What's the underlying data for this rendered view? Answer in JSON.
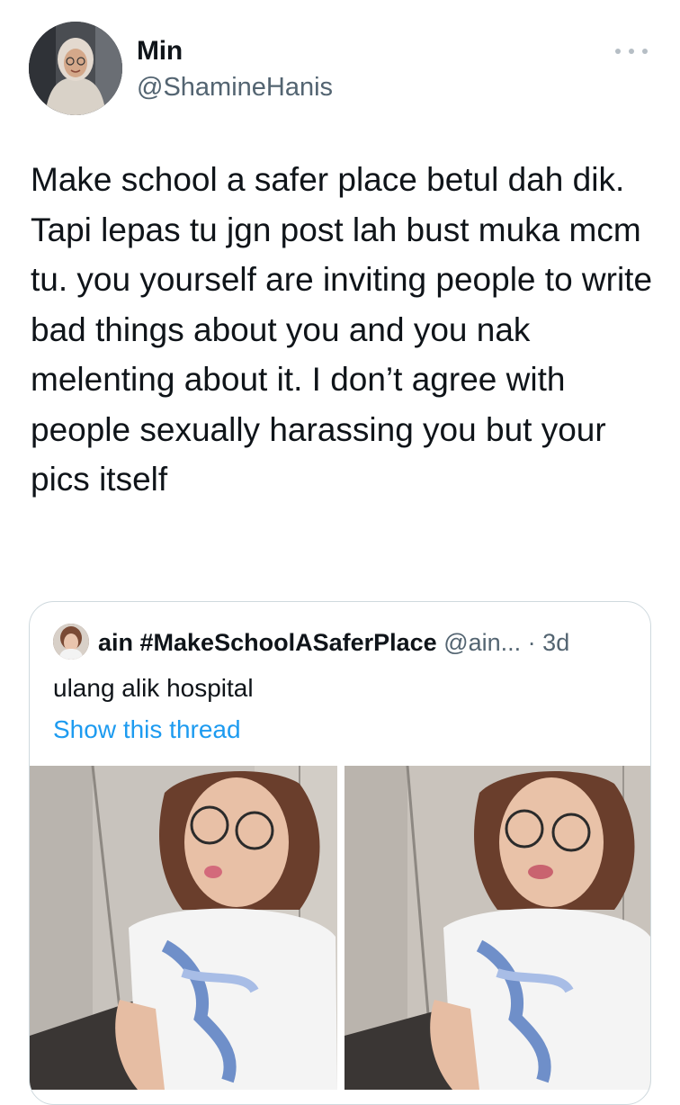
{
  "tweet": {
    "display_name": "Min",
    "handle": "@ShamineHanis",
    "more_icon": "more-horizontal-icon",
    "text": "Make school a safer place betul dah dik. Tapi lepas tu jgn post lah bust muka mcm tu. you yourself are inviting people to write bad things about you and you nak melenting about it. I don’t agree with people sexually harassing you but your pics itself"
  },
  "quoted_tweet": {
    "display_name": "ain #MakeSchoolASaferPlace",
    "handle": "@ain...",
    "separator": "·",
    "time": "3d",
    "text": "ulang alik hospital",
    "show_thread": "Show this thread"
  },
  "colors": {
    "text": "#0f1419",
    "secondary": "#536471",
    "link": "#1d9bf0",
    "border": "#cfd9de"
  }
}
